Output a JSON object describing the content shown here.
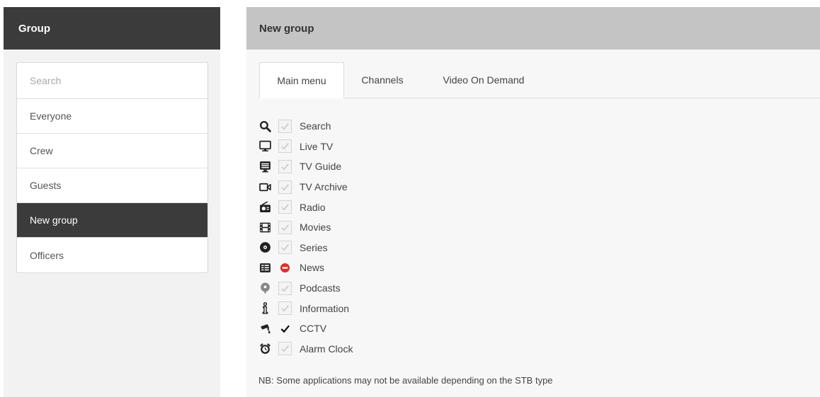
{
  "sidebar": {
    "title": "Group",
    "search_placeholder": "Search",
    "groups": [
      {
        "label": "Everyone",
        "active": false
      },
      {
        "label": "Crew",
        "active": false
      },
      {
        "label": "Guests",
        "active": false
      },
      {
        "label": "New group",
        "active": true
      },
      {
        "label": "Officers",
        "active": false
      }
    ]
  },
  "main": {
    "title": "New group",
    "tabs": [
      {
        "label": "Main menu",
        "active": true
      },
      {
        "label": "Channels",
        "active": false
      },
      {
        "label": "Video On Demand",
        "active": false
      }
    ],
    "apps": [
      {
        "label": "Search",
        "icon": "search-icon",
        "state": "disabled"
      },
      {
        "label": "Live TV",
        "icon": "monitor-icon",
        "state": "disabled"
      },
      {
        "label": "TV Guide",
        "icon": "tv-guide-icon",
        "state": "disabled"
      },
      {
        "label": "TV Archive",
        "icon": "video-camera-icon",
        "state": "disabled"
      },
      {
        "label": "Radio",
        "icon": "radio-icon",
        "state": "disabled"
      },
      {
        "label": "Movies",
        "icon": "film-icon",
        "state": "disabled"
      },
      {
        "label": "Series",
        "icon": "disc-icon",
        "state": "disabled"
      },
      {
        "label": "News",
        "icon": "newspaper-icon",
        "state": "blocked"
      },
      {
        "label": "Podcasts",
        "icon": "podcast-icon",
        "state": "disabled"
      },
      {
        "label": "Information",
        "icon": "info-icon",
        "state": "disabled"
      },
      {
        "label": "CCTV",
        "icon": "cctv-icon",
        "state": "checked"
      },
      {
        "label": "Alarm Clock",
        "icon": "alarm-clock-icon",
        "state": "disabled"
      }
    ],
    "note": "NB: Some applications may not be available depending on the STB type"
  },
  "colors": {
    "sidebar_header": "#3b3b3b",
    "main_header": "#c4c4c4",
    "active_item": "#3b3b3b",
    "blocked_red": "#d9322c"
  }
}
